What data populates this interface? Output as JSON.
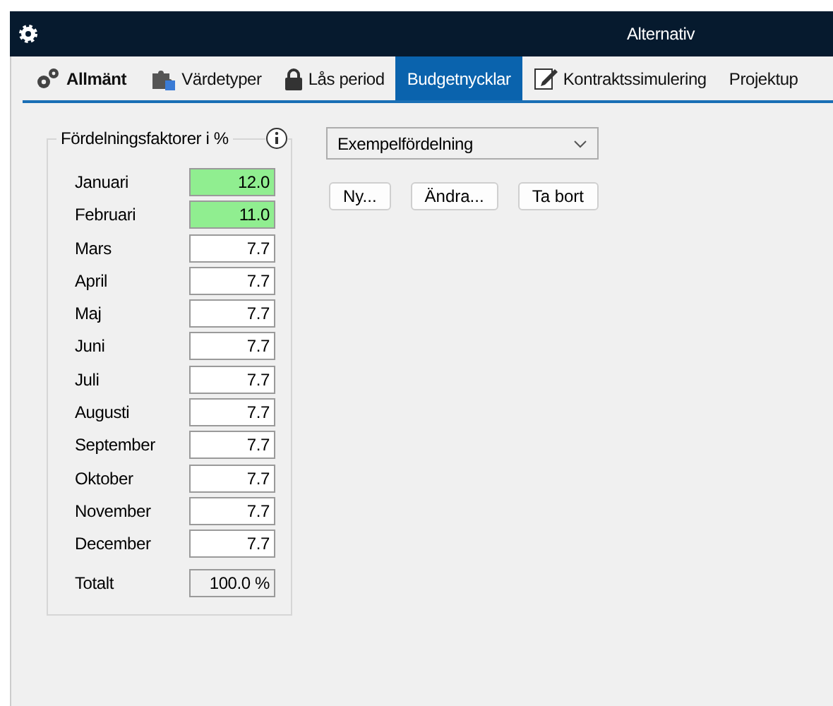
{
  "window": {
    "title": "Alternativ"
  },
  "tabs": [
    {
      "label": "Allmänt",
      "bold": true,
      "selected": false
    },
    {
      "label": "Värdetyper",
      "bold": false,
      "selected": false
    },
    {
      "label": "Lås period",
      "bold": false,
      "selected": false
    },
    {
      "label": "Budgetnycklar",
      "bold": false,
      "selected": true
    },
    {
      "label": "Kontraktssimulering",
      "bold": false,
      "selected": false
    },
    {
      "label": "Projektup",
      "bold": false,
      "selected": false
    }
  ],
  "group": {
    "title": "Fördelningsfaktorer i %",
    "months": [
      {
        "name": "Januari",
        "value": "12.0",
        "highlighted": true
      },
      {
        "name": "Februari",
        "value": "11.0",
        "highlighted": true
      },
      {
        "name": "Mars",
        "value": "7.7",
        "highlighted": false
      },
      {
        "name": "April",
        "value": "7.7",
        "highlighted": false
      },
      {
        "name": "Maj",
        "value": "7.7",
        "highlighted": false
      },
      {
        "name": "Juni",
        "value": "7.7",
        "highlighted": false
      },
      {
        "name": "Juli",
        "value": "7.7",
        "highlighted": false
      },
      {
        "name": "Augusti",
        "value": "7.7",
        "highlighted": false
      },
      {
        "name": "September",
        "value": "7.7",
        "highlighted": false
      },
      {
        "name": "Oktober",
        "value": "7.7",
        "highlighted": false
      },
      {
        "name": "November",
        "value": "7.7",
        "highlighted": false
      },
      {
        "name": "December",
        "value": "7.7",
        "highlighted": false
      }
    ],
    "total": {
      "label": "Totalt",
      "value": "100.0 %"
    }
  },
  "distribution": {
    "value": "Exempelfördelning"
  },
  "buttons": [
    "Ny...",
    "Ändra...",
    "Ta bort"
  ]
}
